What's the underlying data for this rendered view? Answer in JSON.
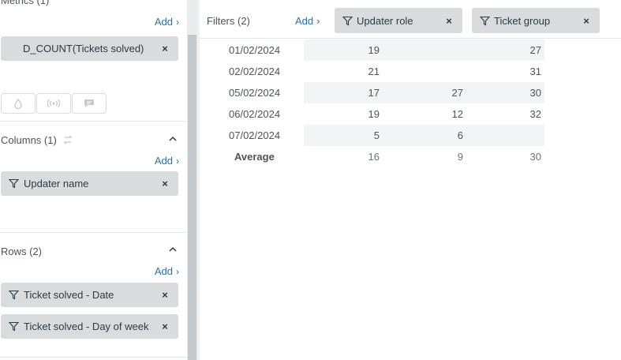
{
  "left_panel": {
    "metrics": {
      "title": "Metrics (1)",
      "add_label": "Add",
      "items": [
        {
          "label": "D_COUNT(Tickets solved)"
        }
      ]
    },
    "columns": {
      "title": "Columns (1)",
      "add_label": "Add",
      "items": [
        {
          "label": "Updater name"
        }
      ]
    },
    "rows": {
      "title": "Rows (2)",
      "add_label": "Add",
      "items": [
        {
          "label": "Ticket solved - Date"
        },
        {
          "label": "Ticket solved - Day of week"
        }
      ]
    }
  },
  "filters": {
    "title": "Filters (2)",
    "add_label": "Add",
    "items": [
      {
        "label": "Updater role"
      },
      {
        "label": "Ticket group"
      }
    ]
  },
  "table": {
    "rows": [
      {
        "date": "01/02/2024",
        "c1": "19",
        "c2": "",
        "c3": "27"
      },
      {
        "date": "02/02/2024",
        "c1": "21",
        "c2": "",
        "c3": "31"
      },
      {
        "date": "05/02/2024",
        "c1": "17",
        "c2": "27",
        "c3": "30"
      },
      {
        "date": "06/02/2024",
        "c1": "19",
        "c2": "12",
        "c3": "32"
      },
      {
        "date": "07/02/2024",
        "c1": "5",
        "c2": "6",
        "c3": ""
      }
    ],
    "average": {
      "label": "Average",
      "c1": "16",
      "c2": "9",
      "c3": "30"
    }
  },
  "icons": {
    "toolbar": [
      "drop-icon",
      "broadcast-icon",
      "chat-icon"
    ],
    "swap": "swap-icon",
    "filter": "funnel-icon",
    "remove": "close-icon"
  },
  "colors": {
    "link": "#1f73b7",
    "pill": "#d8dcde",
    "row_alt": "#f3f4f5"
  }
}
